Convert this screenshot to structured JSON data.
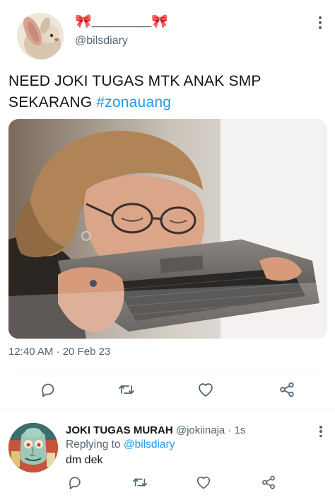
{
  "tweet": {
    "display_name": "🎀________🎀",
    "handle": "@bilsdiary",
    "text_plain": "NEED JOKI TUGAS MTK ANAK SMP SEKARANG ",
    "hashtag": "#zonauang",
    "timestamp": "12:40 AM · 20 Feb 23",
    "icons": {
      "reply": "comment-icon",
      "retweet": "retweet-icon",
      "like": "heart-icon",
      "share": "share-icon",
      "more": "more-vertical-icon"
    }
  },
  "reply": {
    "name": "JOKI TUGAS MURAH",
    "handle_time": "@jokiinaja · 1s",
    "replying_prefix": "Replying to ",
    "replying_to": "@bilsdiary",
    "text": "dm dek"
  },
  "colors": {
    "accent": "#1d9bf0",
    "secondary_text": "#536471",
    "ribbon": "#f06a9a"
  }
}
